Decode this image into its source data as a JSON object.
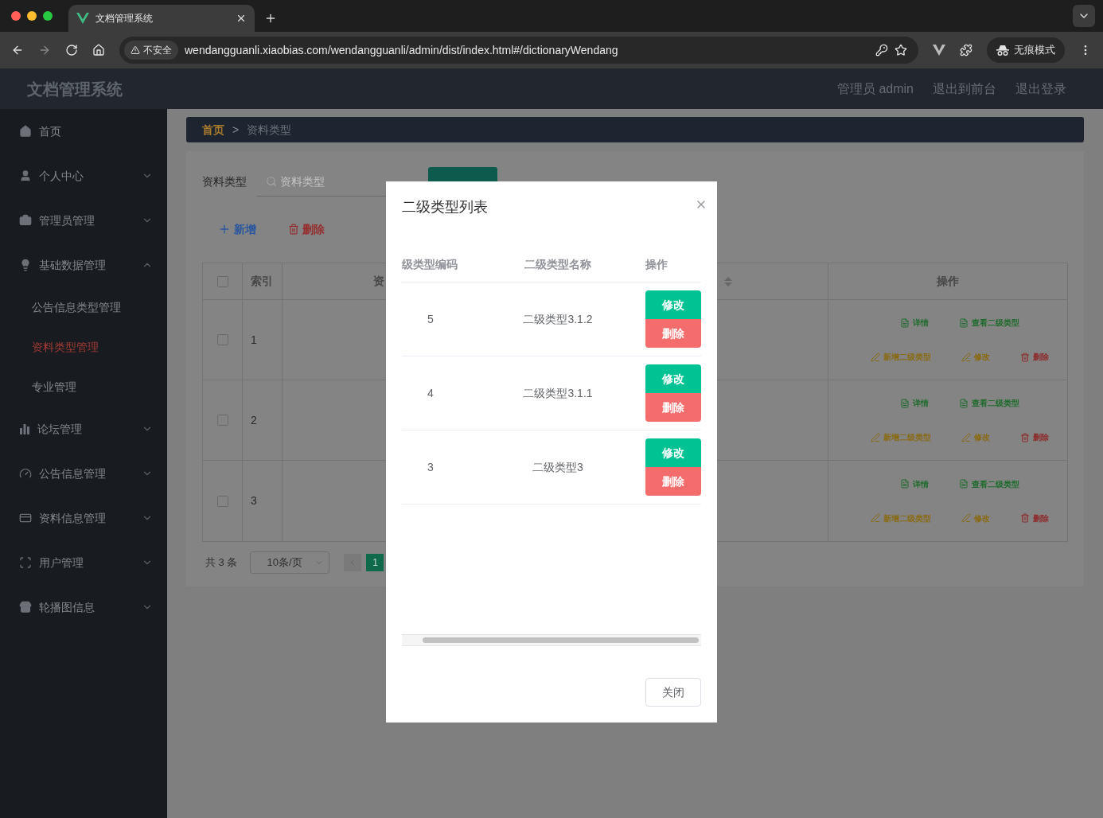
{
  "browser": {
    "tab_title": "文档管理系统",
    "url_badge": "不安全",
    "url": "wendangguanli.xiaobias.com/wendangguanli/admin/dist/index.html#/dictionaryWendang",
    "profile": "无痕模式"
  },
  "header": {
    "title": "文档管理系统",
    "links": [
      "管理员 admin",
      "退出到前台",
      "退出登录"
    ]
  },
  "sidebar": {
    "items": [
      {
        "label": "首页",
        "kind": "link"
      },
      {
        "label": "个人中心",
        "kind": "submenu",
        "expanded": false
      },
      {
        "label": "管理员管理",
        "kind": "submenu",
        "expanded": false
      },
      {
        "label": "基础数据管理",
        "kind": "submenu",
        "expanded": true,
        "children": [
          {
            "label": "公告信息类型管理",
            "selected": false
          },
          {
            "label": "资料类型管理",
            "selected": true
          },
          {
            "label": "专业管理",
            "selected": false
          }
        ]
      },
      {
        "label": "论坛管理",
        "kind": "submenu",
        "expanded": false
      },
      {
        "label": "公告信息管理",
        "kind": "submenu",
        "expanded": false
      },
      {
        "label": "资料信息管理",
        "kind": "submenu",
        "expanded": false
      },
      {
        "label": "用户管理",
        "kind": "submenu",
        "expanded": false
      },
      {
        "label": "轮播图信息",
        "kind": "submenu",
        "expanded": false
      }
    ]
  },
  "breadcrumb": {
    "items": [
      "首页",
      "资料类型"
    ],
    "separator": ">"
  },
  "search": {
    "label": "资料类型",
    "placeholder": "资料类型"
  },
  "toolbar": {
    "add": "新增",
    "delete": "删除"
  },
  "table": {
    "all_checked": false,
    "columns": [
      "索引",
      "资",
      "操作"
    ],
    "rows": [
      {
        "checked": false,
        "index": "1",
        "actions": [
          {
            "kind": "view",
            "label": "详情"
          },
          {
            "kind": "view",
            "label": "查看二级类型"
          },
          {
            "kind": "edit",
            "label": "新增二级类型"
          },
          {
            "kind": "edit",
            "label": "修改"
          },
          {
            "kind": "delete",
            "label": "删除"
          }
        ]
      },
      {
        "checked": false,
        "index": "2",
        "actions": [
          {
            "kind": "view",
            "label": "详情"
          },
          {
            "kind": "view",
            "label": "查看二级类型"
          },
          {
            "kind": "edit",
            "label": "新增二级类型"
          },
          {
            "kind": "edit",
            "label": "修改"
          },
          {
            "kind": "delete",
            "label": "删除"
          }
        ]
      },
      {
        "checked": false,
        "index": "3",
        "actions": [
          {
            "kind": "view",
            "label": "详情"
          },
          {
            "kind": "view",
            "label": "查看二级类型"
          },
          {
            "kind": "edit",
            "label": "新增二级类型"
          },
          {
            "kind": "edit",
            "label": "修改"
          },
          {
            "kind": "delete",
            "label": "删除"
          }
        ]
      }
    ]
  },
  "pagination": {
    "total": "共 3 条",
    "page_size": "10条/页",
    "pages": [
      {
        "label": "1",
        "selected": true
      }
    ]
  },
  "dialog": {
    "title": "二级类型列表",
    "columns": [
      "级类型编码",
      "二级类型名称",
      "操作"
    ],
    "rows": [
      {
        "code": "5",
        "name": "二级类型3.1.2",
        "edit": "修改",
        "delete": "删除"
      },
      {
        "code": "4",
        "name": "二级类型3.1.1",
        "edit": "修改",
        "delete": "删除"
      },
      {
        "code": "3",
        "name": "二级类型3",
        "edit": "修改",
        "delete": "删除"
      }
    ],
    "close_button": "关闭"
  }
}
